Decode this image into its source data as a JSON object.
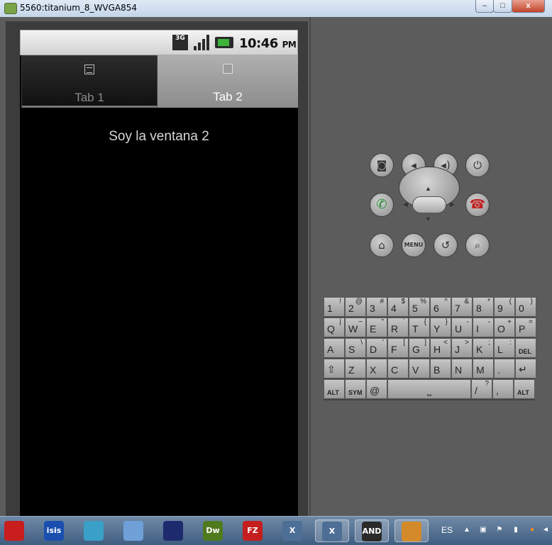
{
  "window": {
    "title": "5560:titanium_8_WVGA854",
    "minimize_label": "–",
    "maximize_label": "□",
    "close_label": "x"
  },
  "status_bar": {
    "network_label": "3G",
    "time": "10:46",
    "ampm": "PM"
  },
  "tabs": [
    {
      "label": "Tab 1",
      "icon": "list-icon",
      "selected": false
    },
    {
      "label": "Tab 2",
      "icon": "window-icon",
      "selected": true
    }
  ],
  "content": {
    "message": "Soy la ventana 2"
  },
  "hardware_buttons": {
    "menu_label": "MENU"
  },
  "keyboard": {
    "row1": [
      {
        "main": "1",
        "alt": "!"
      },
      {
        "main": "2",
        "alt": "@"
      },
      {
        "main": "3",
        "alt": "#"
      },
      {
        "main": "4",
        "alt": "$"
      },
      {
        "main": "5",
        "alt": "%"
      },
      {
        "main": "6",
        "alt": "^"
      },
      {
        "main": "7",
        "alt": "&"
      },
      {
        "main": "8",
        "alt": "*"
      },
      {
        "main": "9",
        "alt": "("
      },
      {
        "main": "0",
        "alt": ")"
      }
    ],
    "row2": [
      {
        "main": "Q",
        "alt": "|"
      },
      {
        "main": "W",
        "alt": "~"
      },
      {
        "main": "E",
        "alt": "\""
      },
      {
        "main": "R",
        "alt": "`"
      },
      {
        "main": "T",
        "alt": "{"
      },
      {
        "main": "Y",
        "alt": "}"
      },
      {
        "main": "U",
        "alt": "-"
      },
      {
        "main": "I",
        "alt": "-"
      },
      {
        "main": "O",
        "alt": "+"
      },
      {
        "main": "P",
        "alt": "="
      }
    ],
    "row3": [
      {
        "main": "A",
        "alt": ""
      },
      {
        "main": "S",
        "alt": "\\"
      },
      {
        "main": "D",
        "alt": "'"
      },
      {
        "main": "F",
        "alt": "["
      },
      {
        "main": "G",
        "alt": "]"
      },
      {
        "main": "H",
        "alt": "<"
      },
      {
        "main": "J",
        "alt": ">"
      },
      {
        "main": "K",
        "alt": ";"
      },
      {
        "main": "L",
        "alt": ":"
      },
      {
        "main": "DEL",
        "alt": ""
      }
    ],
    "row4": [
      {
        "main": "⇧",
        "alt": ""
      },
      {
        "main": "Z",
        "alt": ""
      },
      {
        "main": "X",
        "alt": ""
      },
      {
        "main": "C",
        "alt": ""
      },
      {
        "main": "V",
        "alt": ""
      },
      {
        "main": "B",
        "alt": ""
      },
      {
        "main": "N",
        "alt": ""
      },
      {
        "main": "M",
        "alt": ""
      },
      {
        "main": ".",
        "alt": ""
      },
      {
        "main": "↵",
        "alt": ""
      }
    ],
    "row5": {
      "alt_left": "ALT",
      "sym": "SYM",
      "at": "@",
      "space": "⎵",
      "slash": "/",
      "slash_alt": "?",
      "comma": ",",
      "alt_right": "ALT"
    }
  },
  "taskbar": {
    "apps": [
      {
        "name": "record-app-icon",
        "label": "",
        "color": "#c81e1e"
      },
      {
        "name": "isis-app-icon",
        "label": "isis",
        "color": "#1a4fb0"
      },
      {
        "name": "tool-app-icon",
        "label": "",
        "color": "#3aa0c8"
      },
      {
        "name": "virtualbox-app-icon",
        "label": "",
        "color": "#6fa0d8"
      },
      {
        "name": "eclipse-app-icon",
        "label": "",
        "color": "#1e2a6e"
      },
      {
        "name": "dreamweaver-app-icon",
        "label": "Dw",
        "color": "#4f7a1e"
      },
      {
        "name": "filezilla-app-icon",
        "label": "FZ",
        "color": "#c41e1e"
      },
      {
        "name": "x-app-icon-1",
        "label": "X",
        "color": "#4d6f96"
      },
      {
        "name": "x-app-icon-2",
        "label": "X",
        "color": "#4d6f96"
      },
      {
        "name": "android-app-icon",
        "label": "AND",
        "color": "#2a2a2a"
      },
      {
        "name": "paint-app-icon",
        "label": "",
        "color": "#d48a2a"
      }
    ],
    "language": "ES"
  }
}
